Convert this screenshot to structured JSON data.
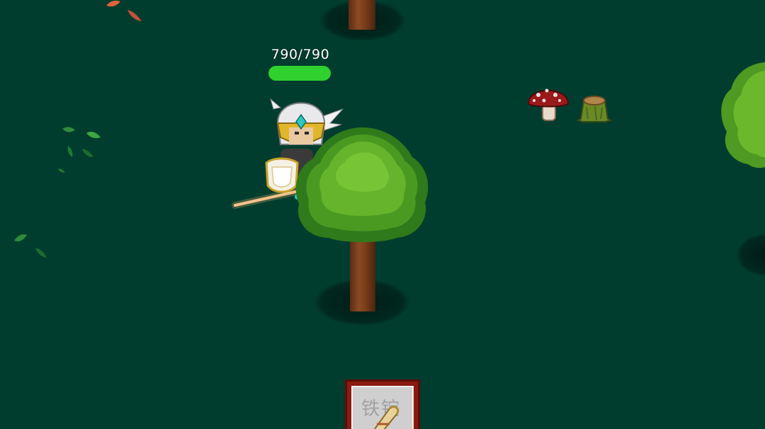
{
  "hud": {
    "hp_text": "790/790",
    "hp_current": 790,
    "hp_max": 790,
    "hp_fill_fraction": 1.0,
    "hp_color": "#2fd12f"
  },
  "scene": {
    "background_color": "#003d2e",
    "objects": [
      "knight-player",
      "large-tree",
      "top-tree",
      "right-tree",
      "red-mushroom",
      "tree-stump",
      "falling-leaves"
    ]
  },
  "hotbar": {
    "slot_item_icon": "scroll-icon",
    "slot_label": "铁锭"
  }
}
